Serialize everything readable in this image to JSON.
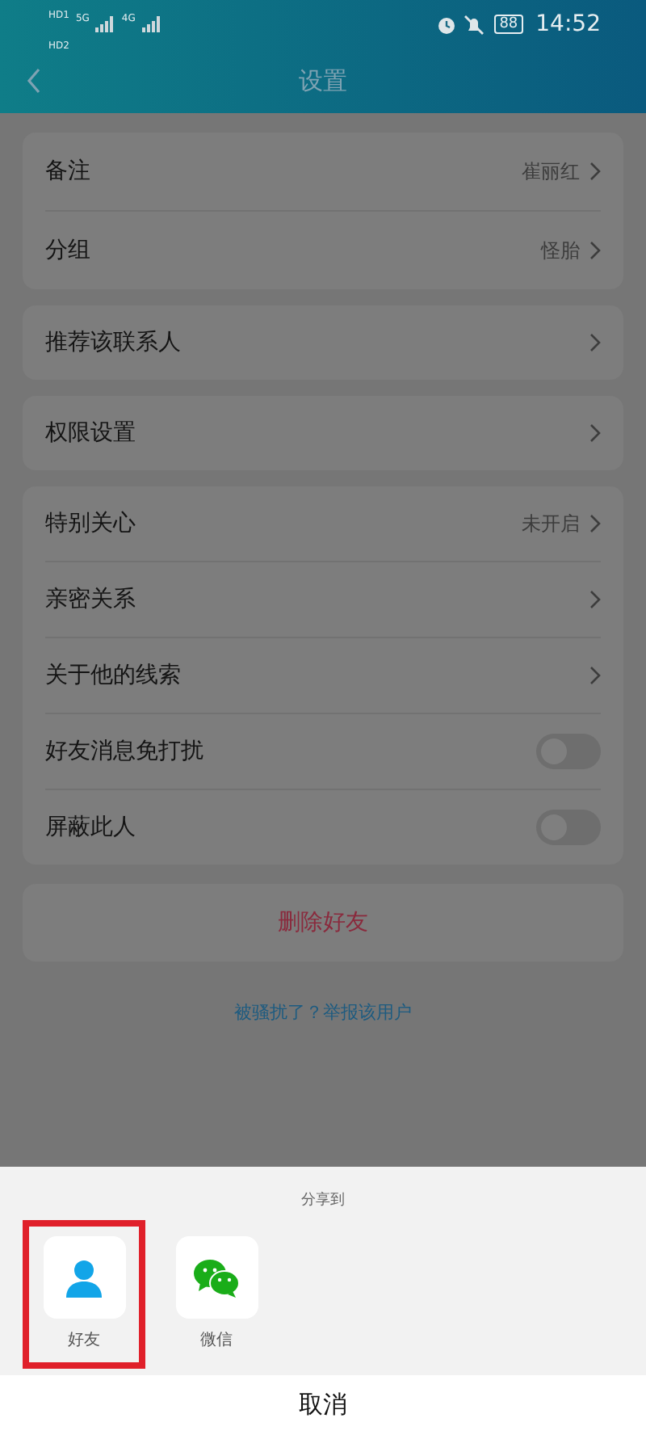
{
  "status_bar": {
    "sims": [
      {
        "label": "HD",
        "slot": "1",
        "network": "5G"
      },
      {
        "label": "HD",
        "slot": "2",
        "network": "4G"
      }
    ],
    "battery": "88",
    "time": "14:52"
  },
  "header": {
    "title": "设置"
  },
  "groups": [
    [
      {
        "kind": "nav",
        "label": "备注",
        "value": "崔丽红"
      },
      {
        "kind": "nav",
        "label": "分组",
        "value": "怪胎"
      }
    ],
    [
      {
        "kind": "nav",
        "label": "推荐该联系人"
      }
    ],
    [
      {
        "kind": "nav",
        "label": "权限设置"
      }
    ],
    [
      {
        "kind": "nav",
        "label": "特别关心",
        "value": "未开启"
      },
      {
        "kind": "nav",
        "label": "亲密关系"
      },
      {
        "kind": "nav",
        "label": "关于他的线索"
      },
      {
        "kind": "toggle",
        "label": "好友消息免打扰",
        "on": false
      },
      {
        "kind": "toggle",
        "label": "屏蔽此人",
        "on": false
      }
    ]
  ],
  "delete_button": "删除好友",
  "report_link": "被骚扰了？举报该用户",
  "share_sheet": {
    "title": "分享到",
    "targets": [
      {
        "kind": "friend",
        "label": "好友",
        "highlighted": true
      },
      {
        "kind": "wechat",
        "label": "微信",
        "highlighted": false
      }
    ],
    "cancel": "取消"
  }
}
